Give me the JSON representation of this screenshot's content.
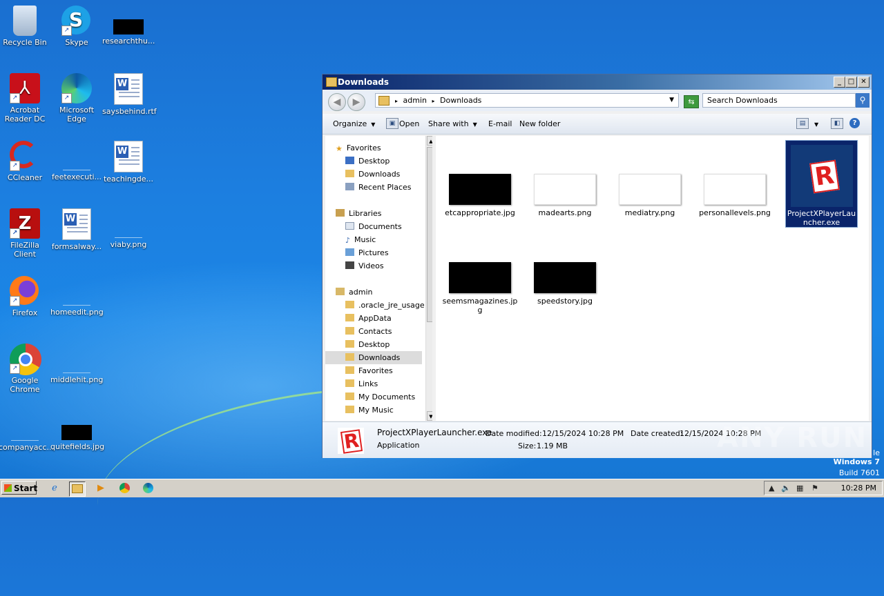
{
  "desktop_icons": [
    {
      "label": "Recycle Bin",
      "icon": "recycle-bin-icon"
    },
    {
      "label": "Skype",
      "icon": "skype-icon"
    },
    {
      "label": "researchthu...",
      "icon": "image-file-icon"
    },
    {
      "label": "Acrobat Reader DC",
      "icon": "acrobat-icon"
    },
    {
      "label": "Microsoft Edge",
      "icon": "edge-icon"
    },
    {
      "label": "saysbehind.rtf",
      "icon": "word-doc-icon"
    },
    {
      "label": "CCleaner",
      "icon": "ccleaner-icon"
    },
    {
      "label": "feetexecuti...",
      "icon": "image-file-icon"
    },
    {
      "label": "teachingde...",
      "icon": "word-doc-icon"
    },
    {
      "label": "FileZilla Client",
      "icon": "filezilla-icon"
    },
    {
      "label": "formsalway...",
      "icon": "word-doc-icon"
    },
    {
      "label": "viaby.png",
      "icon": "image-file-icon"
    },
    {
      "label": "Firefox",
      "icon": "firefox-icon"
    },
    {
      "label": "homeedit.png",
      "icon": "image-file-icon"
    },
    {
      "label": "Google Chrome",
      "icon": "chrome-icon"
    },
    {
      "label": "middlehit.png",
      "icon": "image-file-icon"
    },
    {
      "label": "companyacc...",
      "icon": "image-file-icon"
    },
    {
      "label": "quitefields.jpg",
      "icon": "image-file-icon"
    }
  ],
  "window": {
    "title": "Downloads",
    "address": {
      "segments": [
        "admin",
        "Downloads"
      ],
      "separator": "▸"
    },
    "search_placeholder": "Search Downloads",
    "toolbar": {
      "organize": "Organize",
      "open": "Open",
      "share_with": "Share with",
      "email": "E-mail",
      "new_folder": "New folder"
    },
    "nav": {
      "favorites": "Favorites",
      "fav_items": [
        "Desktop",
        "Downloads",
        "Recent Places"
      ],
      "libraries": "Libraries",
      "lib_items": [
        "Documents",
        "Music",
        "Pictures",
        "Videos"
      ],
      "admin": "admin",
      "admin_items": [
        ".oracle_jre_usage",
        "AppData",
        "Contacts",
        "Desktop",
        "Downloads",
        "Favorites",
        "Links",
        "My Documents",
        "My Music"
      ],
      "selected": "Downloads"
    },
    "files": [
      {
        "name": "etcappropriate.jpg",
        "thumb": "dark"
      },
      {
        "name": "madearts.png",
        "thumb": "light"
      },
      {
        "name": "mediatry.png",
        "thumb": "light"
      },
      {
        "name": "personallevels.png",
        "thumb": "light"
      },
      {
        "name": "ProjectXPlayerLauncher.exe",
        "thumb": "roblox",
        "selected": true
      },
      {
        "name": "seemsmagazines.jpg",
        "thumb": "dark"
      },
      {
        "name": "speedstory.jpg",
        "thumb": "dark"
      }
    ],
    "details": {
      "file_name": "ProjectXPlayerLauncher.exe",
      "type": "Application",
      "date_modified_label": "Date modified:",
      "date_modified": "12/15/2024 10:28 PM",
      "date_created_label": "Date created:",
      "date_created": "12/15/2024 10:28 PM",
      "size_label": "Size:",
      "size": "1.19 MB"
    }
  },
  "taskbar": {
    "start": "Start",
    "clock": "10:28 PM"
  },
  "os_watermark": {
    "edition_partial": "le",
    "os": "Windows 7",
    "build": "Build 7601"
  },
  "brand_watermark": "ANY RUN",
  "colors": {
    "desktop_blue": "#1c7fe0",
    "title_dark": "#0a246a",
    "selection": "#0a246a"
  }
}
